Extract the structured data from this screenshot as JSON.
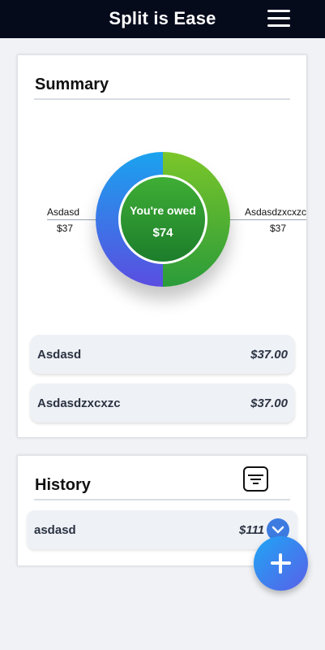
{
  "header": {
    "title": "Split is Ease",
    "menu_icon": "hamburger-menu-icon"
  },
  "summary": {
    "title": "Summary",
    "chart": {
      "center_label": "You're owed",
      "center_amount": "$74",
      "left": {
        "name": "Asdasd",
        "amount": "$37"
      },
      "right": {
        "name": "Asdasdzxcxzc",
        "amount": "$37"
      },
      "colors": {
        "left_top": "#1aa3ef",
        "left_bottom": "#5a4de0",
        "right_top": "#7bc62a",
        "right_bottom": "#2a9b3a"
      }
    },
    "rows": [
      {
        "name": "Asdasd",
        "amount": "$37.00"
      },
      {
        "name": "Asdasdzxcxzc",
        "amount": "$37.00"
      }
    ]
  },
  "history": {
    "title": "History",
    "filter_icon": "filter-icon",
    "items": [
      {
        "name": "asdasd",
        "amount": "$111"
      }
    ]
  },
  "fab": {
    "icon": "plus-icon"
  }
}
